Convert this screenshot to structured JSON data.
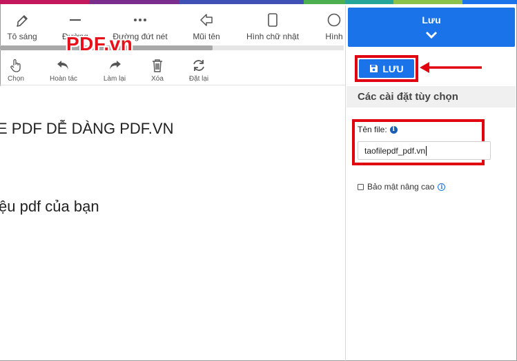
{
  "colors": {
    "accent": "#1a73e8",
    "highlight": "#e00010",
    "watermark": "#e8101a",
    "strip": [
      "#c2185b",
      "#7b2d8e",
      "#3f51b5",
      "#4caf50",
      "#26a69a",
      "#8bc34a",
      "#c2185b"
    ]
  },
  "toolbar": {
    "tools": [
      {
        "label": "Tô sáng",
        "icon": "highlighter-icon"
      },
      {
        "label": "Đường",
        "icon": "line-icon"
      },
      {
        "label": "Đường đứt nét",
        "icon": "dashed-line-icon"
      },
      {
        "label": "Mũi tên",
        "icon": "arrow-icon"
      },
      {
        "label": "Hình chữ nhật",
        "icon": "rectangle-icon"
      },
      {
        "label": "Hình",
        "icon": "ellipse-icon"
      }
    ],
    "actions": [
      {
        "label": "Chọn",
        "icon": "hand-pointer-icon"
      },
      {
        "label": "Hoàn tác",
        "icon": "undo-icon"
      },
      {
        "label": "Làm lại",
        "icon": "redo-icon"
      },
      {
        "label": "Xóa",
        "icon": "trash-icon"
      },
      {
        "label": "Đặt lại",
        "icon": "reset-icon"
      }
    ]
  },
  "watermark": "PDF.vn",
  "document": {
    "line1": "E PDF DỄ DÀNG PDF.VN",
    "line2": "ệu pdf của bạn"
  },
  "panel": {
    "header_label": "Lưu",
    "save_button_label": "LƯU",
    "options_title": "Các cài đặt tùy chọn",
    "file_name_label": "Tên file:",
    "file_name_value": "taofilepdf_pdf.vn",
    "advanced_security_label": "Bảo mật nâng cao",
    "advanced_security_checked": false
  }
}
